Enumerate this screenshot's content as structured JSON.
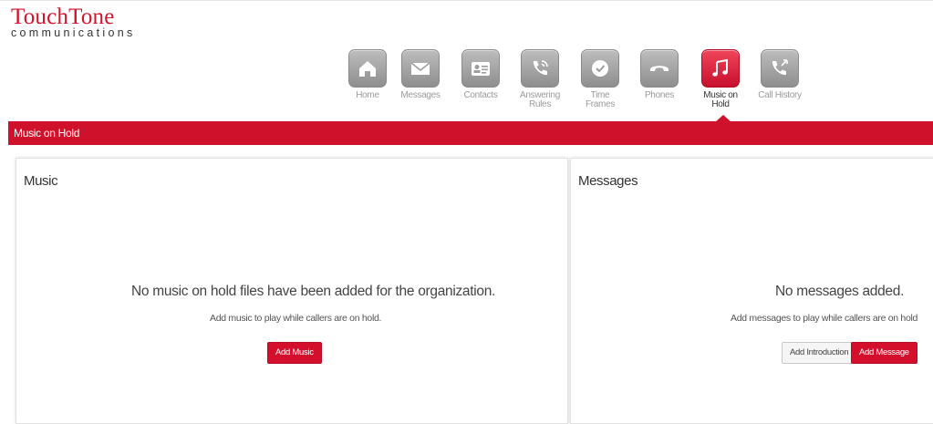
{
  "brand": {
    "name": "TouchTone",
    "tagline": "communications",
    "accent_color": "#d0112b"
  },
  "nav": {
    "items": [
      {
        "key": "home",
        "label_1": "Home",
        "label_2": "",
        "icon": "home-icon"
      },
      {
        "key": "messages",
        "label_1": "Messages",
        "label_2": "",
        "icon": "envelope-icon"
      },
      {
        "key": "contacts",
        "label_1": "Contacts",
        "label_2": "",
        "icon": "contact-card-icon"
      },
      {
        "key": "answering-rules",
        "label_1": "Answering",
        "label_2": "Rules",
        "icon": "phone-waves-icon"
      },
      {
        "key": "time-frames",
        "label_1": "Time",
        "label_2": "Frames",
        "icon": "clock-icon"
      },
      {
        "key": "phones",
        "label_1": "Phones",
        "label_2": "",
        "icon": "handset-icon"
      },
      {
        "key": "music-on-hold",
        "label_1": "Music on",
        "label_2": "Hold",
        "icon": "music-note-icon",
        "active": true
      },
      {
        "key": "call-history",
        "label_1": "Call History",
        "label_2": "",
        "icon": "call-history-icon"
      }
    ]
  },
  "page": {
    "title": "Music on Hold"
  },
  "music_panel": {
    "title": "Music",
    "empty_heading": "No music on hold files have been added for the organization.",
    "empty_sub": "Add music to play while callers are on hold.",
    "add_button": "Add Music"
  },
  "messages_panel": {
    "title": "Messages",
    "empty_heading": "No messages added.",
    "empty_sub": "Add messages to play while callers are on hold",
    "intro_button": "Add Introduction",
    "add_button": "Add Message"
  }
}
